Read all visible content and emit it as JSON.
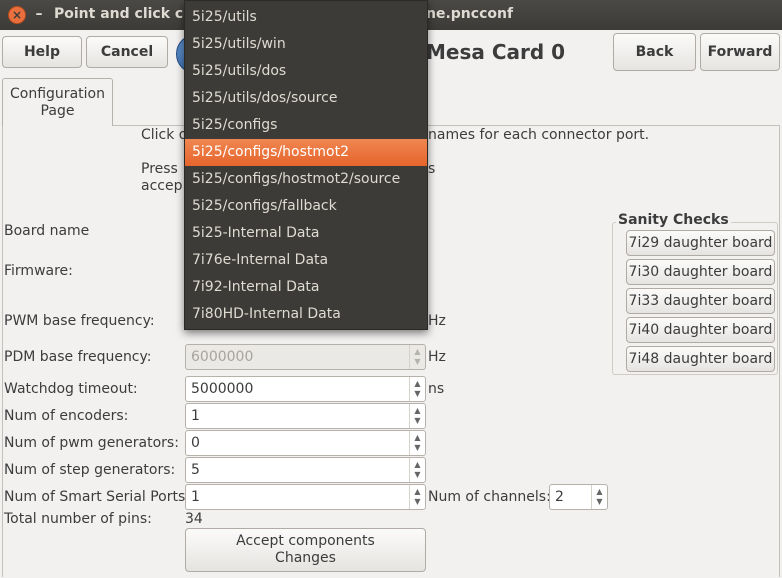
{
  "window": {
    "title_left": "Point and click co",
    "title_right": "ne.pncconf"
  },
  "toolbar": {
    "help_label": "Help",
    "cancel_label": "Cancel",
    "back_label": "Back",
    "forward_label": "Forward"
  },
  "page": {
    "heading": "Mesa Card 0",
    "tab_label_line1": "Configuration",
    "tab_label_line2": "Page",
    "intro_line1_left": "Click o",
    "intro_line1_right": "names for each connector port.",
    "intro_line2_left": "Press",
    "intro_line2_right": "s",
    "intro_line3_left": "accep"
  },
  "form": {
    "board_name_label": "Board name",
    "firmware_label": "Firmware:",
    "pwm_freq_label": "PWM base frequency:",
    "pwm_freq_unit": "Hz",
    "pdm_freq_label": "PDM base frequency:",
    "pdm_freq_value": "6000000",
    "pdm_freq_unit": "Hz",
    "watchdog_label": "Watchdog timeout:",
    "watchdog_value": "5000000",
    "watchdog_unit": "ns",
    "encoders_label": "Num of encoders:",
    "encoders_value": "1",
    "pwm_gen_label": "Num of pwm generators:",
    "pwm_gen_value": "0",
    "step_gen_label": "Num of step generators:",
    "step_gen_value": "5",
    "sserial_label": "Num of Smart Serial Ports:",
    "sserial_value": "1",
    "channels_label": "Num of channels:",
    "channels_value": "2",
    "total_pins_label": "Total number of pins:",
    "total_pins_value": "34",
    "accept_line1": "Accept  components",
    "accept_line2": "Changes"
  },
  "sanity": {
    "title": "Sanity Checks",
    "buttons": [
      "7i29 daughter board",
      "7i30 daughter board",
      "7i33 daughter board",
      "7i40 daughter board",
      "7i48 daughter board"
    ]
  },
  "menu": {
    "selected_index": 5,
    "items": [
      "5i25/utils",
      "5i25/utils/win",
      "5i25/utils/dos",
      "5i25/utils/dos/source",
      "5i25/configs",
      "5i25/configs/hostmot2",
      "5i25/configs/hostmot2/source",
      "5i25/configs/fallback",
      "5i25-Internal Data",
      "7i76e-Internal Data",
      "7i92-Internal Data",
      "7i80HD-Internal Data"
    ]
  },
  "colors": {
    "titlebar": "#3c3b37",
    "menu_bg": "#3c3b37",
    "menu_highlight": "#e9703e",
    "window_bg": "#f2f1f0"
  }
}
